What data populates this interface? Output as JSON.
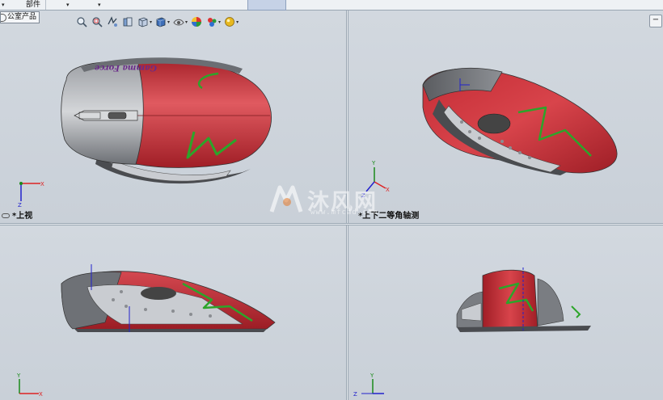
{
  "tabs": {
    "left_dropdown": "▾",
    "parts_label": "部件",
    "dropdown_2": "▾",
    "dropdown_3": "▾"
  },
  "breadcrumb": {
    "label": "公室产品"
  },
  "hud_toolbar": {
    "items": [
      "zoom-to-fit-icon",
      "zoom-area-icon",
      "previous-view-icon",
      "section-view-icon",
      "view-orientation-icon",
      "display-style-icon",
      "hide-show-items-icon",
      "edit-appearance-icon",
      "apply-scene-icon",
      "view-settings-icon"
    ]
  },
  "viewports": {
    "top_left": {
      "label": "*上视"
    },
    "top_right": {
      "label": "*上下二等角轴测"
    }
  },
  "model": {
    "logo_text": "Gamma Force",
    "colors": {
      "body_red": "#c8323a",
      "shell_gray": "#7a7d82",
      "accent_green": "#2ca52a",
      "panel_silver": "#c9ccd1"
    }
  },
  "triad": {
    "x": "X",
    "y": "Y",
    "z": "Z"
  },
  "watermark": {
    "text": "沐风网",
    "url": "www.mfcad.com"
  }
}
